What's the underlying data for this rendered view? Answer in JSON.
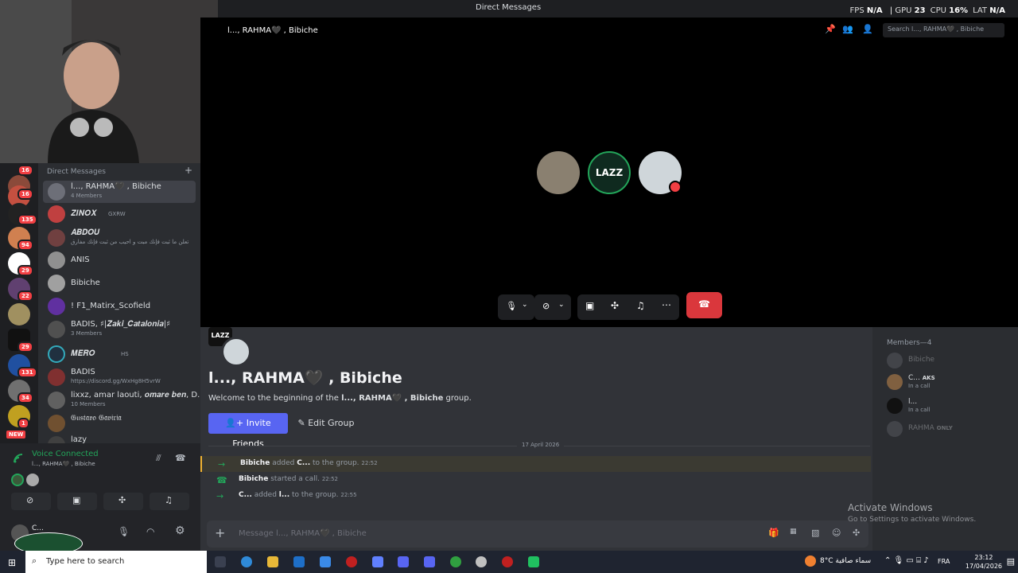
{
  "titlebar": {
    "title": "Direct Messages"
  },
  "overlay": {
    "fps_label": "FPS",
    "fps_value": "N/A",
    "gpu_label": "GPU",
    "gpu_value": "23",
    "cpu_label": "CPU",
    "cpu_value": "16%",
    "lat_label": "LAT",
    "lat_value": "N/A"
  },
  "servers": [
    {
      "badge": "16"
    },
    {
      "badge": "16"
    },
    {
      "badge": "135"
    },
    {
      "badge": "94"
    },
    {
      "badge": "29"
    },
    {
      "badge": "22"
    },
    {
      "badge": ""
    },
    {
      "badge": "29"
    },
    {
      "badge": "131"
    },
    {
      "badge": "34"
    },
    {
      "badge": "1"
    },
    {
      "badge": "NEW"
    }
  ],
  "dm": {
    "header": "Direct Messages",
    "items": [
      {
        "name": "l..., RAHMA🖤 , Bibiche",
        "sub": "4 Members"
      },
      {
        "name": "𝒁𝑰𝑵𝑶𝑿",
        "sub": "GXRW"
      },
      {
        "name": "𝑨𝑩𝑫𝑶𝑼",
        "sub": "تعلن ما ثبت فإنك مبت و احيب من ثبت فإنك مفارق"
      },
      {
        "name": "ANIS",
        "sub": ""
      },
      {
        "name": "Bibiche",
        "sub": ""
      },
      {
        "name": "! F1_Matirx_Scofield",
        "sub": ""
      },
      {
        "name": "BADIS, ♯|𝒁𝒂𝒌𝒊_𝑪𝒂𝒕𝒂𝒍𝒐𝒏𝒊𝒂|♯",
        "sub": "3 Members"
      },
      {
        "name": "𝑴𝑬𝑹𝑶",
        "sub": "HS"
      },
      {
        "name": "BADIS",
        "sub": "https://discord.gg/WxHg8H5vrW"
      },
      {
        "name": "lixxz, amar laouti, 𝒐𝒎𝒂𝒓𝒆 𝒃𝒆𝒏, D...",
        "sub": "10 Members"
      },
      {
        "name": "𝔊𝔲𝔰𝔱𝔞𝔳𝔬 𝔊𝔞𝔳𝔦𝔯𝔦𝔞",
        "sub": ""
      },
      {
        "name": "lazy",
        "sub": ""
      }
    ]
  },
  "voice": {
    "title": "Voice Connected",
    "sub": "l..., RAHMA🖤 , Bibiche"
  },
  "user": {
    "name": "C..."
  },
  "video": {
    "title": "l..., RAHMA🖤 , Bibiche",
    "search_placeholder": "Search l..., RAHMA🖤 , Bibiche"
  },
  "chat": {
    "group_badge": "LAZZ",
    "title": "l..., RAHMA🖤 , Bibiche",
    "welcome_prefix": "Welcome to the beginning of the ",
    "welcome_name": "l..., RAHMA🖤 , Bibiche",
    "welcome_suffix": " group.",
    "invite_label": "Invite Friends",
    "edit_label": "Edit Group",
    "date": "17 April 2026",
    "messages": [
      {
        "a": "Bibiche",
        "t1": " added ",
        "b": "C...",
        "t2": " to the group. ",
        "time": "22:52"
      },
      {
        "a": "Bibiche",
        "t1": " started a call. ",
        "b": "",
        "t2": "",
        "time": "22:52"
      },
      {
        "a": "C...",
        "t1": " added ",
        "b": "l...",
        "t2": " to the group. ",
        "time": "22:55"
      }
    ],
    "input_placeholder": "Message l..., RAHMA🖤 , Bibiche"
  },
  "members": {
    "header": "Members—4",
    "list": [
      {
        "name": "Bibiche",
        "status": ""
      },
      {
        "name": "C...",
        "tag": "AKS",
        "status": "In a call"
      },
      {
        "name": "l...",
        "status": "In a call"
      },
      {
        "name": "RAHMA",
        "tag": "ONLY",
        "status": ""
      }
    ]
  },
  "watermark": {
    "line1": "Activate Windows",
    "line2": "Go to Settings to activate Windows."
  },
  "taskbar": {
    "search_placeholder": "Type here to search",
    "weather": "8°C  سماء صافية",
    "lang": "FRA",
    "time": "23:12",
    "date": "17/04/2026"
  }
}
